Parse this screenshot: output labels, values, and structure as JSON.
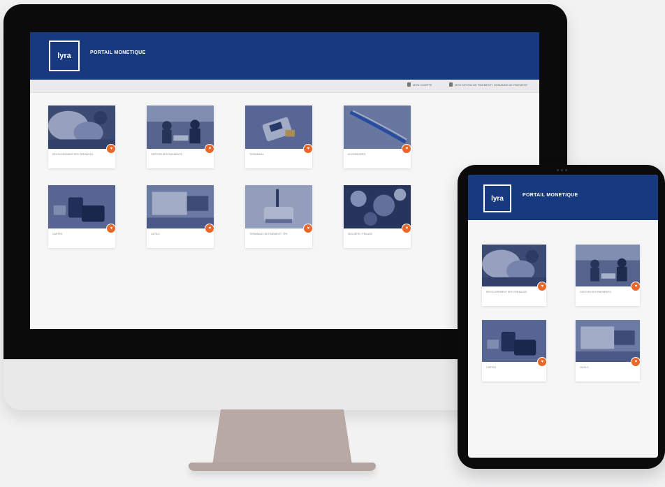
{
  "desktop": {
    "header": {
      "logo_text": "lyra",
      "title": "PORTAIL MONETIQUE"
    },
    "toolbar": [
      {
        "label": "MON COMPTE"
      },
      {
        "label": "MON MOYEN DE PAIEMENT / DEMANDE DE PAIEMENT"
      }
    ],
    "cards": [
      {
        "label": "RECOUVREMENT DES CREANCES",
        "scene": "crowd"
      },
      {
        "label": "GESTION DES PAIEMENTS",
        "scene": "meeting"
      },
      {
        "label": "TERMINAUX",
        "scene": "terminal"
      },
      {
        "label": "ACCESSOIRES",
        "scene": "cable"
      },
      {
        "label": "CARTES",
        "scene": "phone"
      },
      {
        "label": "OUTILS",
        "scene": "desk"
      },
      {
        "label": "TERMINAUX DE PAIEMENT / TPE",
        "scene": "router"
      },
      {
        "label": "SECURITE / FRAUDE",
        "scene": "aerial"
      }
    ],
    "badge_icon": "heart-icon"
  },
  "tablet": {
    "header": {
      "logo_text": "lyra",
      "title": "PORTAIL MONETIQUE"
    },
    "cards": [
      {
        "label": "RECOUVREMENT DES CREANCES",
        "scene": "crowd"
      },
      {
        "label": "GESTION DES PAIEMENTS",
        "scene": "meeting"
      },
      {
        "label": "CARTES",
        "scene": "phone"
      },
      {
        "label": "OUTILS",
        "scene": "desk"
      }
    ],
    "badge_icon": "heart-icon"
  },
  "colors": {
    "header_blue": "#16397f",
    "badge_orange": "#e8672a",
    "screen_bg": "#f6f6f7",
    "device_black": "#0b0b0c",
    "stand": "#b8a9a5"
  }
}
